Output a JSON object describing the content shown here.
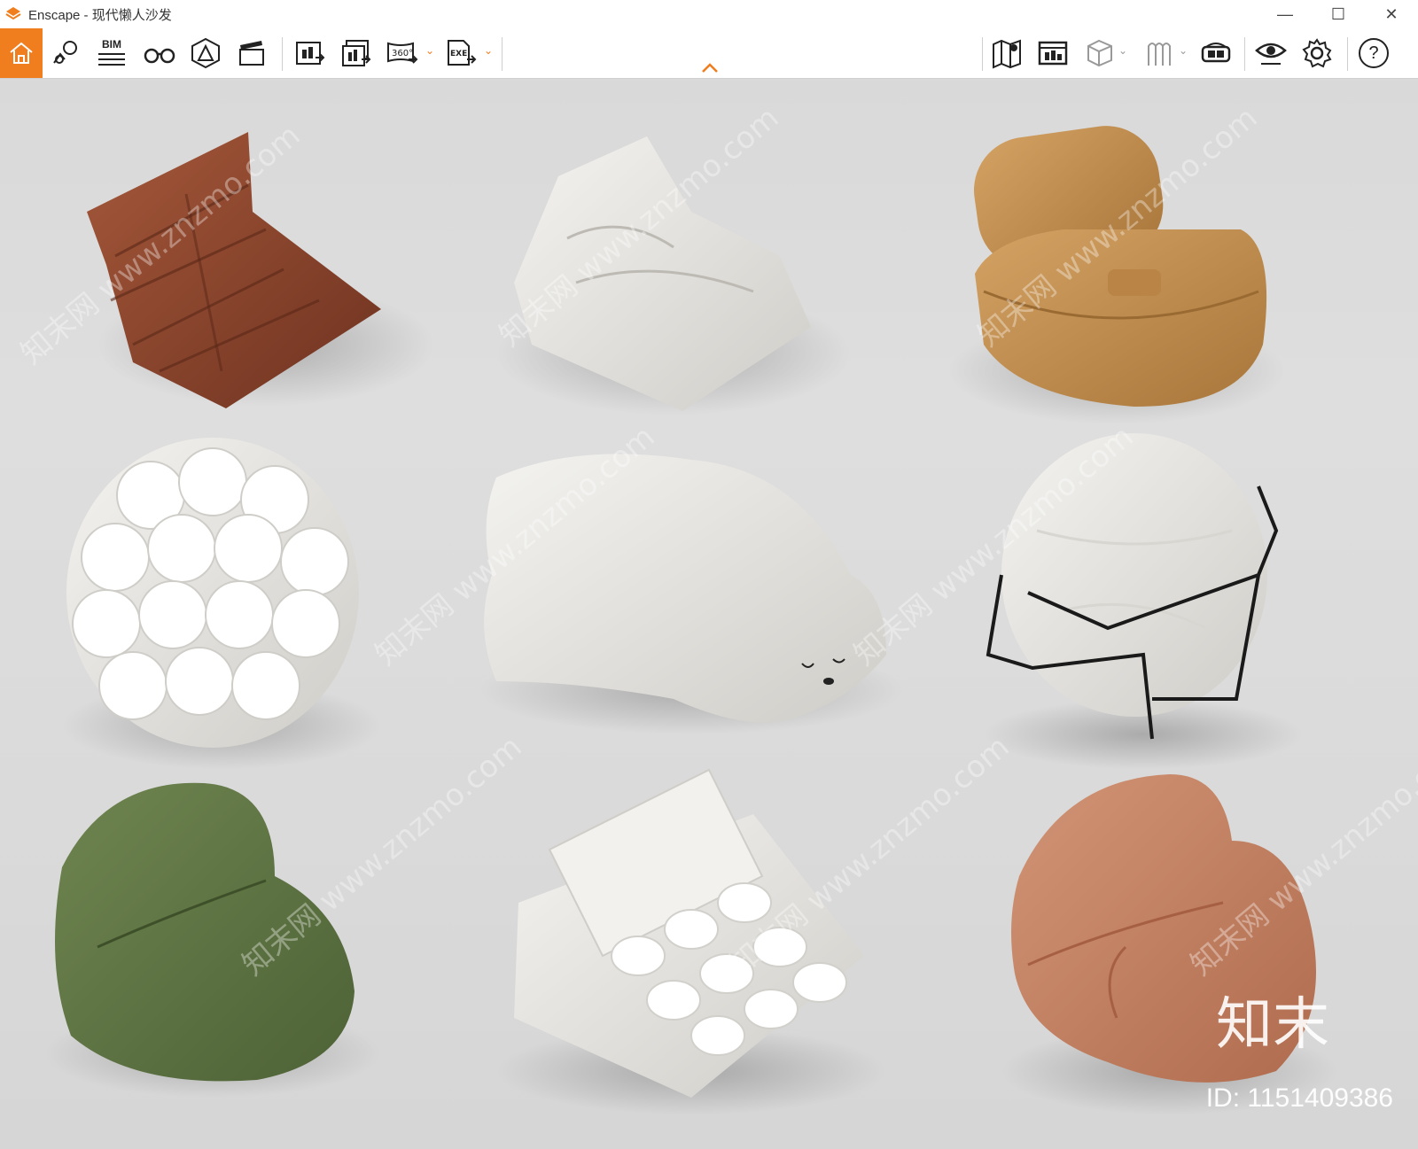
{
  "window": {
    "app_name": "Enscape",
    "title": "Enscape - 现代懒人沙发",
    "minimize": "—",
    "maximize": "☐",
    "close": "✕"
  },
  "toolbar": {
    "bim_label": "BIM",
    "pano_label": "360°",
    "exe_label": "EXE",
    "help_label": "?",
    "accent_color": "#f07d1e"
  },
  "viewport": {
    "watermark_text": "知末网 www.znzmo.com",
    "brand_logo": "知末",
    "id_label": "ID: 1151409386"
  },
  "icons": [
    "home-icon",
    "location-pin-icon",
    "bim-icon",
    "binoculars-icon",
    "perspective-icon",
    "clapperboard-icon",
    "screenshot-icon",
    "batch-render-icon",
    "panorama-icon",
    "exe-export-icon",
    "map-icon",
    "asset-library-icon",
    "view-cube-icon",
    "rendering-style-icon",
    "vr-headset-icon",
    "visual-settings-icon",
    "settings-gear-icon",
    "help-icon"
  ]
}
